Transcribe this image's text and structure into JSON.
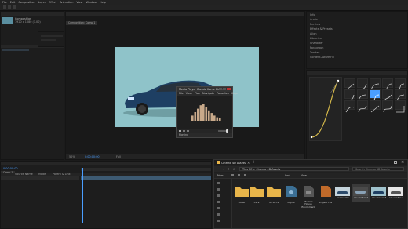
{
  "menu": {
    "items": [
      "File",
      "Edit",
      "Composition",
      "Layer",
      "Effect",
      "Animation",
      "View",
      "Window",
      "Help"
    ]
  },
  "project_panel": {
    "tab_label": "Project",
    "item_name": "Composition",
    "item_meta": "1920 x 1080 (1.00)"
  },
  "composition_panel": {
    "tab_label": "Composition",
    "comp_name": "Comp 1",
    "footer_zoom": "50%",
    "footer_time": "0:00:00:00",
    "footer_quality": "Full"
  },
  "right_panel": {
    "header_items": [
      "Info",
      "Audio",
      "Preview",
      "Effects & Presets",
      "Align",
      "Libraries",
      "Character",
      "Paragraph",
      "Tracker",
      "Content-Aware Fill"
    ]
  },
  "ease_panel": {
    "tab_label": "Flow",
    "graph_axis_label": ""
  },
  "timeline": {
    "tab_label": "Comp 1",
    "time": "0:00:00:00",
    "layer_cols": [
      "Source Name",
      "Mode",
      "Parent & Link"
    ]
  },
  "media_player": {
    "title": "Media Player Classic Home Cinema",
    "menu": [
      "File",
      "View",
      "Play",
      "Navigate",
      "Favorites",
      "Help"
    ],
    "status": "Playing",
    "eq_bars": [
      0.3,
      0.5,
      0.7,
      0.9,
      1.0,
      0.8,
      0.6,
      0.45,
      0.3,
      0.2,
      0.15
    ]
  },
  "explorer": {
    "title": "Cinema 4D Assets",
    "path": "This PC > Cinema 4D Assets",
    "search_placeholder": "Search Cinema 4D Assets",
    "toolbar": [
      "New",
      "Sort",
      "View"
    ],
    "items": [
      {
        "name": "Audio",
        "type": "folder"
      },
      {
        "name": "Cars",
        "type": "folder"
      },
      {
        "name": "4K LUTS",
        "type": "folder"
      },
      {
        "name": "Lights",
        "type": "file"
      },
      {
        "name": "Modern House Enviroment",
        "type": "file"
      },
      {
        "name": "Project File",
        "type": "file"
      },
      {
        "name": "car render",
        "type": "image"
      },
      {
        "name": "car render 2",
        "type": "image"
      },
      {
        "name": "car render 3",
        "type": "image"
      },
      {
        "name": "car render 4",
        "type": "image"
      }
    ]
  },
  "colors": {
    "background": "#1b1b1b",
    "car_bg": "#8fc3c9",
    "car_body": "#1e3f63",
    "accent": "#4a9eff",
    "folder": "#e8b54a",
    "ease_curve": "#d4b84a"
  }
}
